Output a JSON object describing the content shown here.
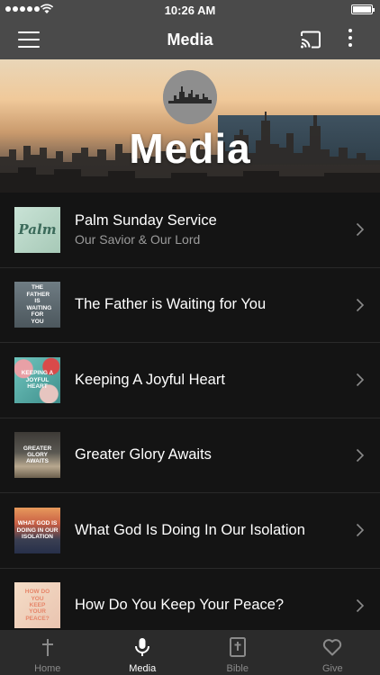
{
  "status": {
    "time": "10:26 AM"
  },
  "nav": {
    "title": "Media"
  },
  "hero": {
    "title": "Media"
  },
  "items": [
    {
      "title": "Palm Sunday Service",
      "subtitle": "Our Savior & Our Lord",
      "thumb_text": "Palm"
    },
    {
      "title": "The Father is Waiting for You",
      "subtitle": "",
      "thumb_text": "THE FATHER IS WAITING FOR YOU"
    },
    {
      "title": "Keeping A Joyful Heart",
      "subtitle": "",
      "thumb_text": "KEEPING A JOYFUL HEART"
    },
    {
      "title": "Greater Glory Awaits",
      "subtitle": "",
      "thumb_text": "GREATER GLORY AWAITS"
    },
    {
      "title": "What God Is Doing In Our Isolation",
      "subtitle": "",
      "thumb_text": "WHAT GOD IS DOING IN OUR ISOLATION"
    },
    {
      "title": "How Do You Keep Your Peace?",
      "subtitle": "",
      "thumb_text": "HOW DO YOU KEEP YOUR PEACE?"
    }
  ],
  "tabs": [
    {
      "label": "Home",
      "icon": "cross-icon"
    },
    {
      "label": "Media",
      "icon": "microphone-icon",
      "active": true
    },
    {
      "label": "Bible",
      "icon": "bible-icon"
    },
    {
      "label": "Give",
      "icon": "heart-icon"
    }
  ],
  "colors": {
    "background": "#141414",
    "bar": "#4a4a4a",
    "tab_bar": "#2b2b2b",
    "subtitle": "#9b9b9b"
  }
}
